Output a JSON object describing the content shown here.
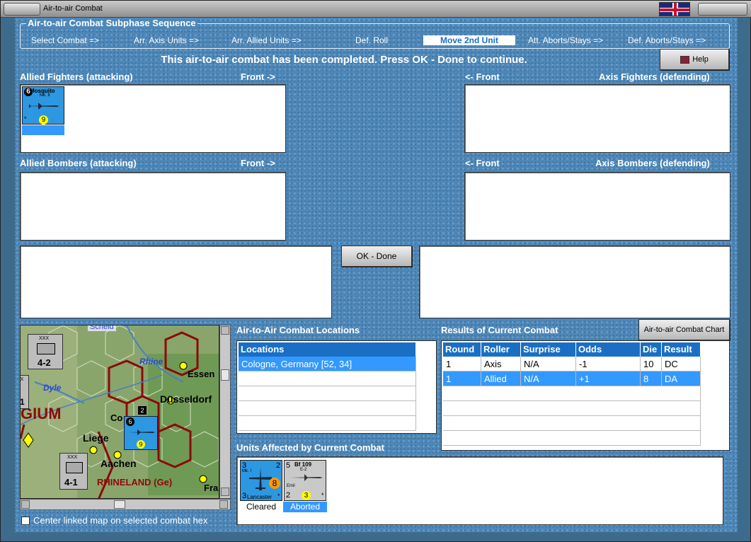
{
  "window": {
    "title": "Air-to-air Combat"
  },
  "sequence": {
    "legend": "Air-to-air Combat Subphase Sequence",
    "steps": [
      "Select Combat =>",
      "Arr. Axis Units =>",
      "Arr. Allied Units =>",
      "Def. Roll",
      "Move 2nd Unit",
      "Att. Aborts/Stays =>",
      "Def. Aborts/Stays =>"
    ],
    "active": "Move 2nd Unit"
  },
  "message": "This air-to-air combat has been completed.  Press OK - Done to continue.",
  "help_label": "Help",
  "panels": {
    "allied_fighters": "Allied Fighters (attacking)",
    "front_right": "Front ->",
    "front_left": "<- Front",
    "axis_fighters": "Axis Fighters (defending)",
    "allied_bombers": "Allied Bombers (attacking)",
    "axis_bombers": "Axis Bombers (defending)"
  },
  "ok_label": "OK - Done",
  "allied_fighter_unit": {
    "name": "Mosquito",
    "model": "Mk. II",
    "strength": "6",
    "range": "9",
    "asterisk": "*"
  },
  "locations": {
    "title": "Air-to-Air Combat Locations",
    "header": "Locations",
    "rows": [
      "Cologne, Germany [52, 34]"
    ]
  },
  "results": {
    "title": "Results of Current Combat",
    "chart_button": "Air-to-air Combat Chart",
    "headers": [
      "Round",
      "Roller",
      "Surprise",
      "Odds",
      "Die",
      "Result"
    ],
    "rows": [
      [
        "1",
        "Axis",
        "N/A",
        "-1",
        "10",
        "DC"
      ],
      [
        "1",
        "Allied",
        "N/A",
        "+1",
        "8",
        "DA"
      ]
    ]
  },
  "affected": {
    "title": "Units Affected by Current Combat",
    "units": [
      {
        "name": "Lancaster",
        "model": "Mk. I",
        "left_top": "3",
        "left_bottom": "3",
        "right_top": "2",
        "range": "8",
        "asterisk": "*",
        "status": "Cleared"
      },
      {
        "name": "Bf 109",
        "model": "E-2",
        "sub": "Emil",
        "left_top": "5",
        "left_bottom": "2",
        "range": "3",
        "asterisk": "*",
        "status": "Aborted"
      }
    ]
  },
  "map": {
    "labels": {
      "rhine": "Rhine",
      "essen": "Essen",
      "dyle": "Dyle",
      "dusseldorf": "Düsseldorf",
      "gium": "GIUM",
      "liege": "Liege",
      "aachen": "Aachen",
      "rhineland": "RHINELAND (Ge)",
      "fra": "Fra",
      "co": "Co",
      "scheldt": "Scheld"
    },
    "units": [
      {
        "str": "4-2",
        "label": "XXX"
      },
      {
        "str": "-1",
        "label": "XX"
      },
      {
        "str": "4-1",
        "label": "XXX"
      }
    ],
    "fighter_str": "6",
    "fighter_range": "9",
    "stack": "2"
  },
  "center_checkbox": "Center linked map on selected combat hex"
}
